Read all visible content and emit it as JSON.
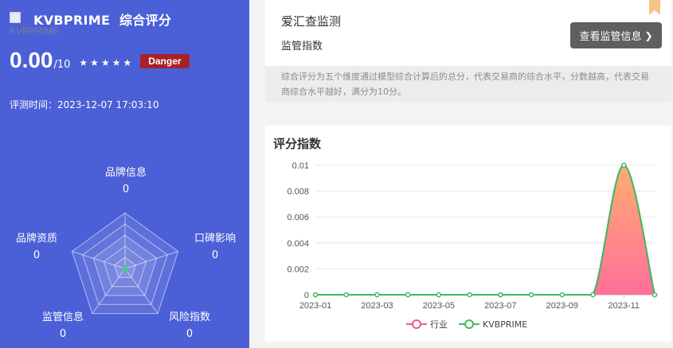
{
  "broker": {
    "logo_alt": "KVBPRIME",
    "title": "KVBPRIME  综合评分",
    "score": "0.00",
    "score_total": "/10",
    "stars": "★★★★★",
    "star_rating": 0,
    "risk_badge": "Danger",
    "test_time": "评测时间：2023-12-07 17:03:10"
  },
  "radar": {
    "dimensions": [
      {
        "label": "品牌信息",
        "value": "0"
      },
      {
        "label": "口碑影响",
        "value": "0"
      },
      {
        "label": "风险指数",
        "value": "0"
      },
      {
        "label": "监管信息",
        "value": "0"
      },
      {
        "label": "品牌资质",
        "value": "0"
      }
    ]
  },
  "monitor": {
    "title": "爱汇查监测",
    "subtitle": "监管指数",
    "view_button": "查看监管信息",
    "description": "综合评分为五个维度通过模型综合计算后的总分，代表交易商的综合水平，分数越高，代表交易商综合水平越好，满分为10分。"
  },
  "chart_title": "评分指数",
  "chart_data": {
    "type": "area",
    "title": "评分指数",
    "xlabel": "",
    "ylabel": "",
    "x_ticks": [
      "2023-01",
      "2023-03",
      "2023-05",
      "2023-07",
      "2023-09",
      "2023-11"
    ],
    "y_ticks": [
      "0",
      "0.002",
      "0.004",
      "0.006",
      "0.008",
      "0.01"
    ],
    "ylim": [
      0,
      0.01
    ],
    "x": [
      "2023-01",
      "2023-02",
      "2023-03",
      "2023-04",
      "2023-05",
      "2023-06",
      "2023-07",
      "2023-08",
      "2023-09",
      "2023-10",
      "2023-11",
      "2023-12"
    ],
    "series": [
      {
        "name": "行业",
        "color": "#f0588a",
        "values": [
          0,
          0,
          0,
          0,
          0,
          0,
          0,
          0,
          0,
          0,
          0.01,
          0
        ]
      },
      {
        "name": "KVBPRIME",
        "color": "#3dbb5c",
        "values": [
          0,
          0,
          0,
          0,
          0,
          0,
          0,
          0,
          0,
          0,
          0.01,
          0
        ]
      }
    ],
    "grid": true,
    "legend": "bottom"
  },
  "colors": {
    "panel": "#4b5fd6",
    "danger": "#a8212a",
    "button": "#5f5f5f",
    "bookmark": "#f5c48a"
  },
  "icons": {
    "star": "star-icon",
    "chevron": "chevron-right-icon",
    "bookmark": "bookmark-icon"
  }
}
